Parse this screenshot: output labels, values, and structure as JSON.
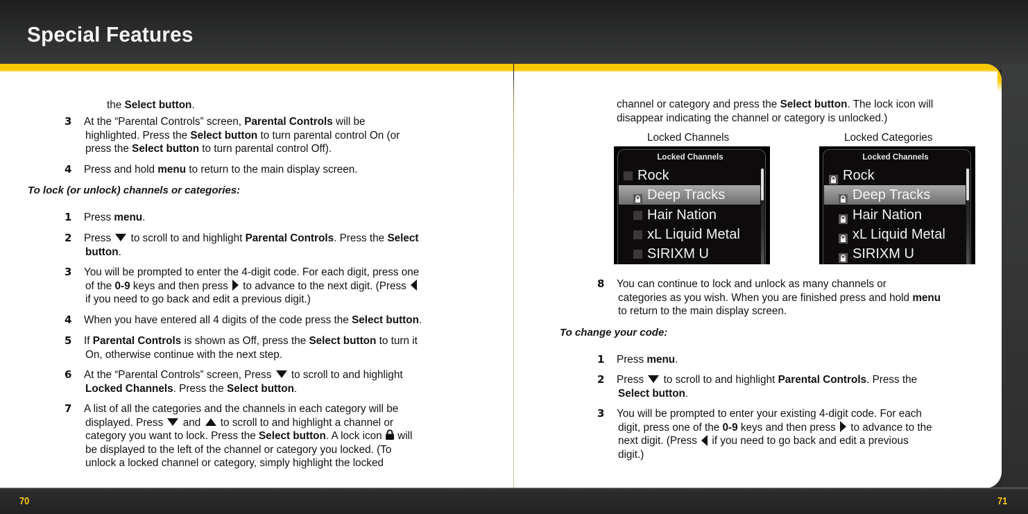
{
  "header": {
    "title": "Special Features"
  },
  "colors": {
    "accent_yellow": "#fcc800",
    "band_dark": "#2c2d2d",
    "page_bg": "#ffffff"
  },
  "footer": {
    "left_page_number": "70",
    "right_page_number": "71"
  },
  "left_page": {
    "intro_cont": {
      "pre": "the ",
      "bold": "Select button",
      "post": "."
    },
    "steps_a": [
      {
        "num": "3",
        "lines": [
          [
            {
              "t": "At the “Parental Controls” screen, "
            },
            {
              "b": "Parental Controls"
            },
            {
              "t": " will be"
            }
          ],
          [
            {
              "t": "highlighted. Press the "
            },
            {
              "b": "Select button"
            },
            {
              "t": " to turn parental control On (or"
            }
          ],
          [
            {
              "t": "press the "
            },
            {
              "b": "Select button"
            },
            {
              "t": " to turn parental control Off)."
            }
          ]
        ]
      },
      {
        "num": "4",
        "lines": [
          [
            {
              "t": "Press and hold "
            },
            {
              "b": "menu"
            },
            {
              "t": " to return to the main display screen."
            }
          ]
        ]
      }
    ],
    "heading": "To lock (or unlock) channels or categories:",
    "steps_b": [
      {
        "num": "1",
        "lines": [
          [
            {
              "t": "Press "
            },
            {
              "b": "menu"
            },
            {
              "t": "."
            }
          ]
        ]
      },
      {
        "num": "2",
        "lines": [
          [
            {
              "t": "Press "
            },
            {
              "icon": "down"
            },
            {
              "t": " to scroll to and highlight "
            },
            {
              "b": "Parental Controls"
            },
            {
              "t": ". Press the "
            },
            {
              "b": "Select"
            }
          ],
          [
            {
              "b": "button"
            },
            {
              "t": "."
            }
          ]
        ]
      },
      {
        "num": "3",
        "lines": [
          [
            {
              "t": "You will be prompted to enter the 4-digit code. For each digit, press one"
            }
          ],
          [
            {
              "t": "of the "
            },
            {
              "b": "0-9"
            },
            {
              "t": " keys and then press "
            },
            {
              "icon": "right"
            },
            {
              "t": " to advance to the next digit. (Press "
            },
            {
              "icon": "left"
            }
          ],
          [
            {
              "t": "if you need to go back and edit a previous digit.)"
            }
          ]
        ]
      },
      {
        "num": "4",
        "lines": [
          [
            {
              "t": "When you have entered all 4 digits of the code press the "
            },
            {
              "b": "Select button"
            },
            {
              "t": "."
            }
          ]
        ]
      },
      {
        "num": "5",
        "lines": [
          [
            {
              "t": "If "
            },
            {
              "b": "Parental Controls"
            },
            {
              "t": " is shown as Off, press the "
            },
            {
              "b": "Select button"
            },
            {
              "t": " to turn it"
            }
          ],
          [
            {
              "t": "On, otherwise continue with the next step."
            }
          ]
        ]
      },
      {
        "num": "6",
        "lines": [
          [
            {
              "t": "At the “Parental Controls” screen, Press "
            },
            {
              "icon": "down"
            },
            {
              "t": " to scroll to and highlight"
            }
          ],
          [
            {
              "b": "Locked Channels"
            },
            {
              "t": ". Press the "
            },
            {
              "b": "Select button"
            },
            {
              "t": "."
            }
          ]
        ]
      },
      {
        "num": "7",
        "lines": [
          [
            {
              "t": "A list of all the categories and the channels in each category will be"
            }
          ],
          [
            {
              "t": "displayed. Press "
            },
            {
              "icon": "down"
            },
            {
              "t": " and "
            },
            {
              "icon": "up"
            },
            {
              "t": " to scroll to and highlight a channel or"
            }
          ],
          [
            {
              "t": "category you want to lock. Press the "
            },
            {
              "b": "Select button"
            },
            {
              "t": ". A lock icon "
            },
            {
              "icon": "lock"
            },
            {
              "t": " will"
            }
          ],
          [
            {
              "t": "be displayed to the left of the channel or category you locked. (To"
            }
          ],
          [
            {
              "t": "unlock a locked channel or category, simply highlight the locked"
            }
          ]
        ]
      }
    ]
  },
  "right_page": {
    "cont_lines": [
      [
        {
          "t": "channel or category and press the "
        },
        {
          "b": "Select button"
        },
        {
          "t": ". The lock icon will"
        }
      ],
      [
        {
          "t": "disappear indicating the channel or category is unlocked.)"
        }
      ]
    ],
    "figures": [
      {
        "caption": "Locked Channels",
        "screen_title": "Locked Channels",
        "rows": [
          {
            "label": "Rock",
            "indent": false,
            "locked": false,
            "selected": false
          },
          {
            "label": "Deep Tracks",
            "indent": true,
            "locked": true,
            "selected": true
          },
          {
            "label": "Hair Nation",
            "indent": true,
            "locked": false,
            "selected": false
          },
          {
            "label": "xL Liquid Metal",
            "indent": true,
            "locked": false,
            "selected": false
          },
          {
            "label": "SIRIXM U",
            "indent": true,
            "locked": false,
            "selected": false
          }
        ]
      },
      {
        "caption": "Locked Categories",
        "screen_title": "Locked Channels",
        "rows": [
          {
            "label": "Rock",
            "indent": false,
            "locked": true,
            "selected": false
          },
          {
            "label": "Deep Tracks",
            "indent": true,
            "locked": true,
            "selected": true
          },
          {
            "label": "Hair Nation",
            "indent": true,
            "locked": true,
            "selected": false
          },
          {
            "label": "xL Liquid Metal",
            "indent": true,
            "locked": true,
            "selected": false
          },
          {
            "label": "SIRIXM U",
            "indent": true,
            "locked": true,
            "selected": false
          }
        ]
      }
    ],
    "step8": {
      "num": "8",
      "lines": [
        [
          {
            "t": "You can continue to lock and unlock as many channels or"
          }
        ],
        [
          {
            "t": "categories as you wish. When you are finished press and hold "
          },
          {
            "b": "menu"
          }
        ],
        [
          {
            "t": "to return to the main display screen."
          }
        ]
      ]
    },
    "heading": "To change your code:",
    "steps": [
      {
        "num": "1",
        "lines": [
          [
            {
              "t": "Press "
            },
            {
              "b": "menu"
            },
            {
              "t": "."
            }
          ]
        ]
      },
      {
        "num": "2",
        "lines": [
          [
            {
              "t": "Press "
            },
            {
              "icon": "down"
            },
            {
              "t": " to scroll to and highlight "
            },
            {
              "b": "Parental Controls"
            },
            {
              "t": ". Press the"
            }
          ],
          [
            {
              "b": "Select button"
            },
            {
              "t": "."
            }
          ]
        ]
      },
      {
        "num": "3",
        "lines": [
          [
            {
              "t": "You will be prompted to enter your existing 4-digit code. For each"
            }
          ],
          [
            {
              "t": "digit, press one of the "
            },
            {
              "b": "0-9"
            },
            {
              "t": " keys and then press "
            },
            {
              "icon": "right"
            },
            {
              "t": " to advance to the"
            }
          ],
          [
            {
              "t": "next digit. (Press "
            },
            {
              "icon": "left"
            },
            {
              "t": " if you need to go back and edit a previous"
            }
          ],
          [
            {
              "t": "digit.)"
            }
          ]
        ]
      }
    ]
  }
}
